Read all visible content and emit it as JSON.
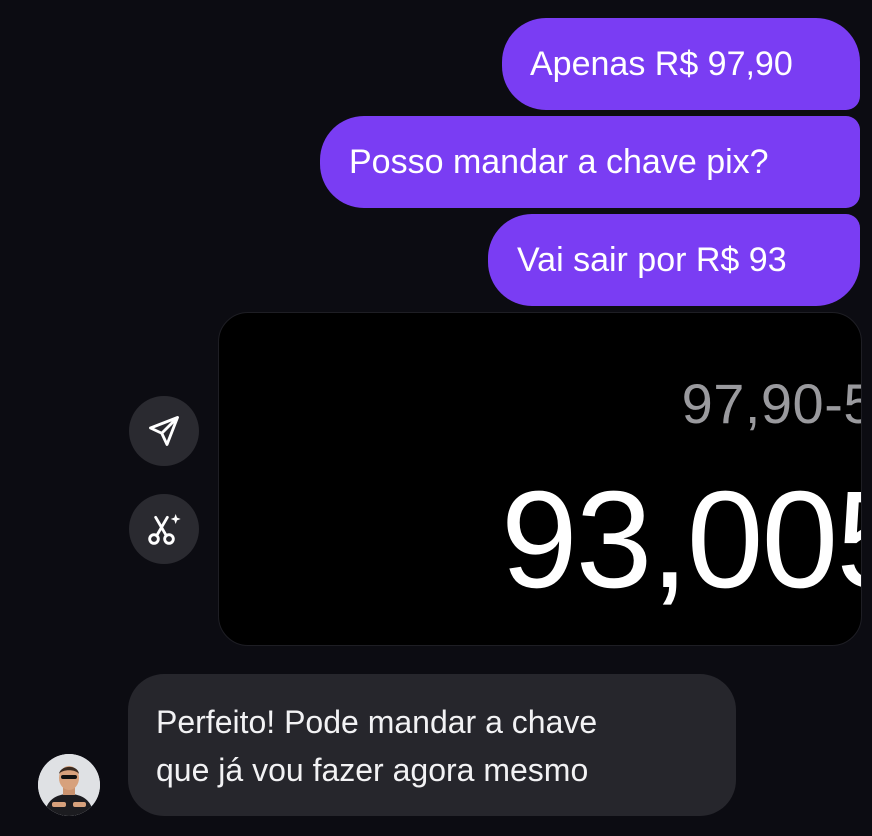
{
  "messages": {
    "outgoing": [
      "Apenas R$ 97,90",
      "Posso mandar a chave pix?",
      "Vai sair por R$ 93"
    ],
    "image": {
      "small_text": "97,90-5",
      "big_text": "93,005"
    },
    "incoming": {
      "line1": "Perfeito! Pode mandar a chave",
      "line2": "que já vou fazer agora mesmo"
    }
  },
  "actions": {
    "share_icon": "send-triangle-icon",
    "remix_icon": "scissors-sparkle-icon"
  },
  "colors": {
    "background": "#0c0c12",
    "outgoing_bubble": "#7a3df3",
    "incoming_bubble": "#26262c",
    "action_button": "#2a2a30"
  }
}
